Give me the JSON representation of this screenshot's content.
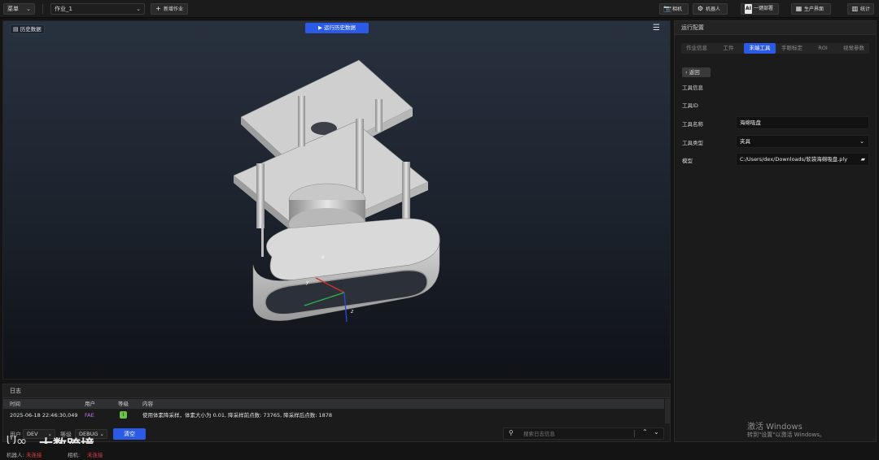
{
  "topbar": {
    "menu_label": "菜单",
    "job_select": "作业_1",
    "new_job_label": "新增作业",
    "buttons": [
      {
        "icon": "camera-icon",
        "label": "相机"
      },
      {
        "icon": "robot-arm-icon",
        "label": "机器人"
      },
      {
        "icon": "ai-icon",
        "label": "一键部署"
      },
      {
        "icon": "production-icon",
        "label": "生产界面"
      },
      {
        "icon": "stats-icon",
        "label": "统计"
      }
    ]
  },
  "viewport": {
    "history_label": "历史数据",
    "run_label": "运行历史数据",
    "axes": {
      "x": "x",
      "y": "y",
      "z": "z"
    }
  },
  "log": {
    "title": "日志",
    "columns": [
      "时间",
      "用户",
      "等级",
      "内容"
    ],
    "rows": [
      {
        "time": "2025-06-18 22:46:30,049",
        "user": "FAE",
        "level": "I",
        "content": "使用体素降采样，体素大小为 0.01, 降采样前点数: 73765, 降采样后点数: 1878"
      }
    ],
    "filter_user_label": "用户",
    "filter_user_value": "DEV",
    "filter_level_label": "等级",
    "filter_level_value": "DEBUG",
    "clear_label": "清空",
    "search_placeholder": "搜索日志信息"
  },
  "panel": {
    "title": "运行配置",
    "tabs": [
      "作业信息",
      "工件",
      "末端工具",
      "手眼标定",
      "ROI",
      "视觉参数"
    ],
    "active_tab": 2,
    "back_label": "返回",
    "section_title": "工具信息",
    "tool_id_label": "工具ID",
    "tool_name_label": "工具名称",
    "tool_name_value": "海绵吸盘",
    "tool_type_label": "工具类型",
    "tool_type_value": "夹具",
    "model_label": "模型",
    "model_value": "C:/Users/dex/Downloads/软袋海绵吸盘.ply"
  },
  "watermark": {
    "line1": "激活 Windows",
    "line2": "转到\"设置\"以激活 Windows。"
  },
  "brand": {
    "text": "大数跨境"
  },
  "status": {
    "robot_label": "机器人:",
    "robot_value": "未连接",
    "camera_label": "相机:",
    "camera_value": "未连接"
  },
  "colors": {
    "accent": "#2b5ae6",
    "error": "#e03a3a",
    "level_info": "#6cc04a",
    "user_fae": "#b778e0"
  }
}
